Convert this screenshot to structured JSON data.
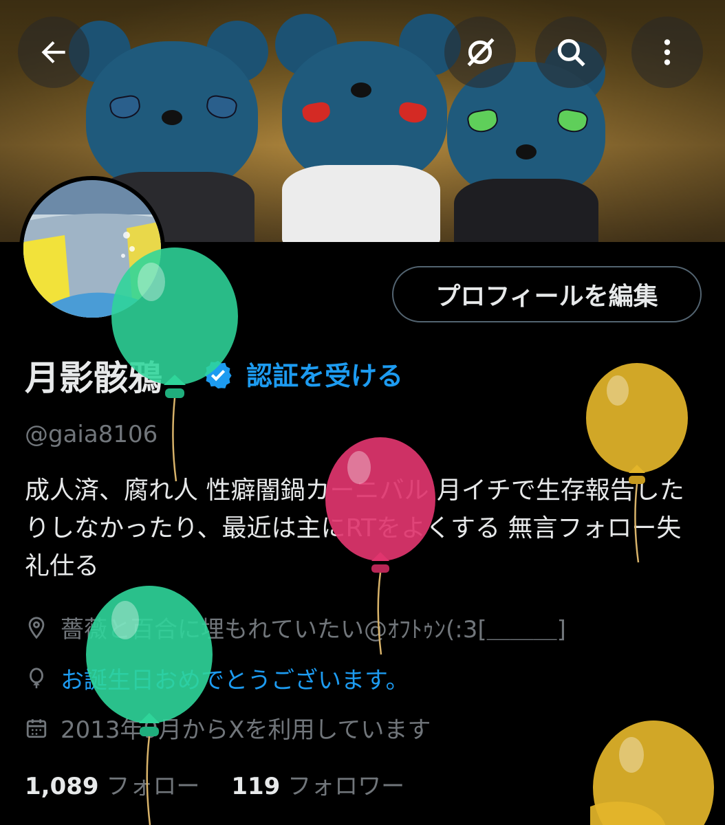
{
  "profile": {
    "display_name": "月影骸鴉",
    "verify_link": "認証を受ける",
    "handle": "@gaia8106",
    "bio": "成人済、腐れ人 性癖闇鍋カーニバル 月イチで生存報告したりしなかったり、最近は主にRTをよくする 無言フォロー失礼仕る",
    "location": "薔薇と百合に埋もれていたい@ｵﾌﾄｩﾝ(:3[＿＿＿]",
    "birthday": "お誕生日おめでとうございます。",
    "joined": "2013年9月からXを利用しています",
    "following_count": "1,089",
    "following_label": "フォロー",
    "followers_count": "119",
    "followers_label": "フォロワー"
  },
  "buttons": {
    "edit_profile": "プロフィールを編集"
  },
  "icons": {
    "back": "back-arrow-icon",
    "grok": "grok-icon",
    "search": "search-icon",
    "more": "more-vertical-icon",
    "verified": "verified-badge-icon",
    "location": "location-icon",
    "birthday": "balloon-icon",
    "calendar": "calendar-icon"
  },
  "colors": {
    "accent": "#1d9bf0",
    "muted": "#71767b",
    "text": "#e7e9ea",
    "background": "#000000",
    "balloon_green": "#2fd59a",
    "balloon_pink": "#e0356e",
    "balloon_yellow": "#e3b52a"
  }
}
